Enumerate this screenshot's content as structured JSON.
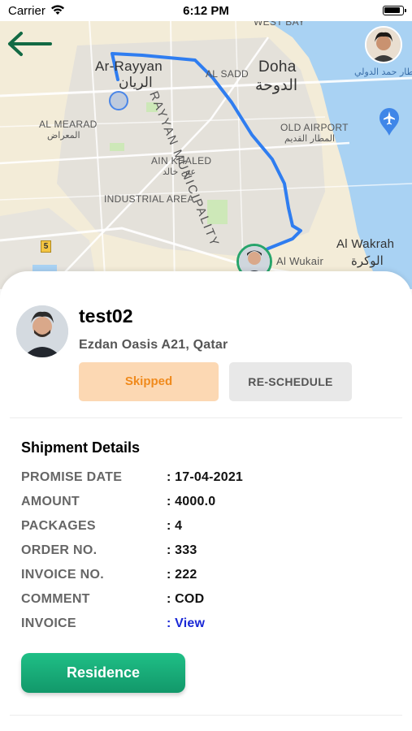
{
  "status_bar": {
    "carrier": "Carrier",
    "time": "6:12 PM"
  },
  "map": {
    "labels": {
      "west_bay": "WEST BAY",
      "ar_rayyan": "Ar-Rayyan",
      "ar_rayyan_ar": "الريان",
      "al_sadd": "AL SADD",
      "doha": "Doha",
      "doha_ar": "الدوحة",
      "rayyan_municipality": "RAYYAN MUNICIPALITY",
      "al_mearad": "AL MEARAD",
      "al_mearad_ar": "المعراض",
      "old_airport": "OLD AIRPORT",
      "old_airport_ar": "المطار القديم",
      "ain_khaled": "AIN KHALED",
      "ain_khaled_ar": "عين خالد",
      "industrial_area": "INDUSTRIAL AREA",
      "al_wakrah": "Al Wakrah",
      "al_wakrah_ar": "الوكرة",
      "al_wukair": "Al Wukair",
      "hamad_airport": "Hamad International Airport",
      "hamad_airport_ar": "مطار حمد الدولي",
      "road_number": "5"
    },
    "colors": {
      "route": "#2f7df0",
      "water": "#a9d2f3",
      "land": "#f3ecd8",
      "urban": "#e4e1da",
      "park": "#cde8b8"
    }
  },
  "customer": {
    "name": "test02",
    "address": "Ezdan Oasis A21, Qatar"
  },
  "actions": {
    "skipped_label": "Skipped",
    "reschedule_label": "RE-SCHEDULE"
  },
  "shipment": {
    "title": "Shipment Details",
    "rows": [
      {
        "key": "PROMISE DATE",
        "value": ": 17-04-2021"
      },
      {
        "key": "AMOUNT",
        "value": ": 4000.0"
      },
      {
        "key": "PACKAGES",
        "value": ": 4"
      },
      {
        "key": "ORDER NO.",
        "value": ": 333"
      },
      {
        "key": "INVOICE NO.",
        "value": ": 222"
      },
      {
        "key": "COMMENT",
        "value": ": COD"
      },
      {
        "key": "INVOICE",
        "value": ": View"
      }
    ]
  },
  "footer": {
    "residence_label": "Residence"
  },
  "theme": {
    "accent_green": "#12986a",
    "skipped_bg": "#fcd8b3",
    "skipped_text": "#f08a1c",
    "link_blue": "#1a28d6"
  }
}
